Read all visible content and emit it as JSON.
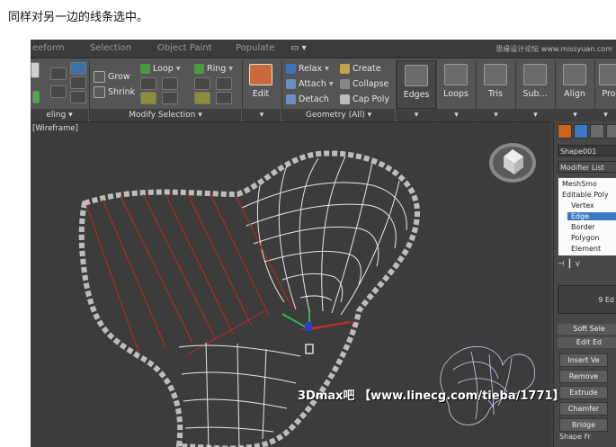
{
  "caption": "同样对另一边的线条选中。",
  "menubar": {
    "items": [
      "eeform",
      "Selection",
      "Object Paint",
      "Populate"
    ],
    "watermark": "思缘设计论坛 www.missyuan.com"
  },
  "ribbon": {
    "modify_selection": {
      "grow_label": "Grow",
      "shrink_label": "Shrink",
      "loop_label": "Loop",
      "ring_label": "Ring",
      "panel_label": "Modify Selection ▾"
    },
    "left_panel_label": "eling ▾",
    "edit_label": "Edit",
    "geometry": {
      "relax_label": "Relax",
      "attach_label": "Attach",
      "detach_label": "Detach",
      "create_label": "Create",
      "collapse_label": "Collapse",
      "cap_poly_label": "Cap Poly",
      "panel_label": "Geometry (All) ▾"
    },
    "big_buttons": [
      "Edges",
      "Loops",
      "Tris",
      "Sub...",
      "Align",
      "Pro"
    ]
  },
  "viewport": {
    "label": "[Wireframe]"
  },
  "command_panel": {
    "object_name": "Shape001",
    "modifier_list_label": "Modifier List",
    "stack": [
      "MeshSmo",
      "Editable Poly",
      "Vertex",
      "Edge",
      "Border",
      "Polygon",
      "Element"
    ],
    "selected_index": 3,
    "selection_count": "9 Ed",
    "soft_selection": "Soft Sele",
    "edit_edges": "Edit Ed",
    "insert_vertex": "Insert Ve",
    "remove_label": "Remove",
    "extrude_label": "Extrude",
    "chamfer_label": "Chamfer",
    "bridge_label": "Bridge",
    "bridge_suffix": "Shape Fr"
  },
  "bottom_watermark": "3Dmax吧 【www.linecg.com/tieba/1771】",
  "colors": {
    "selected_edge": "#b02a2a",
    "wire": "#e8e8e8",
    "stack_selected": "#3c78c8"
  }
}
